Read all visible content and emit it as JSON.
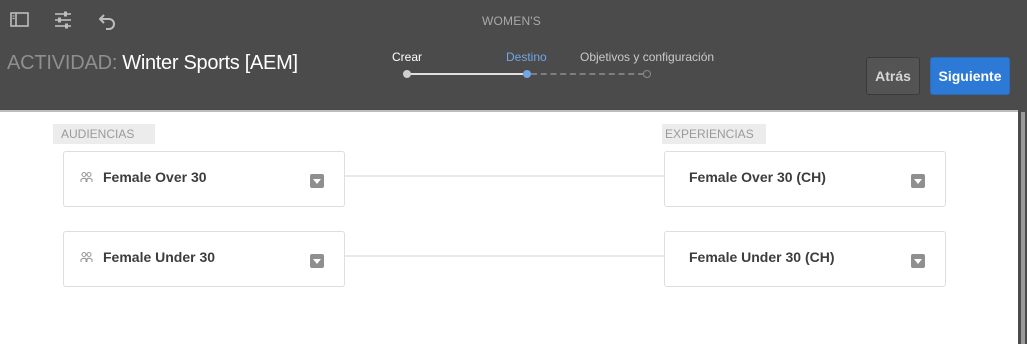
{
  "toolbar": {
    "icons": [
      "sidebar-icon",
      "sliders-icon",
      "undo-icon"
    ],
    "window_title": "WOMEN'S"
  },
  "activity": {
    "prefix": "ACTIVIDAD:",
    "name": "Winter Sports [AEM]"
  },
  "stepper": {
    "steps": [
      {
        "label": "Crear",
        "state": "done"
      },
      {
        "label": "Destino",
        "state": "current"
      },
      {
        "label": "Objetivos y configuración",
        "state": "todo"
      }
    ]
  },
  "actions": {
    "back_label": "Atrás",
    "next_label": "Siguiente"
  },
  "audiences": {
    "header": "AUDIENCIAS",
    "items": [
      {
        "name": "Female Over 30",
        "icon": "people-icon"
      },
      {
        "name": "Female Under 30",
        "icon": "people-icon"
      }
    ]
  },
  "experiences": {
    "header": "EXPERIENCIAS",
    "items": [
      {
        "name": "Female Over 30 (CH)"
      },
      {
        "name": "Female Under 30 (CH)"
      }
    ]
  },
  "colors": {
    "header_bg": "#4b4b4b",
    "accent_blue": "#2d7ad6",
    "current_step": "#73a6e6"
  }
}
